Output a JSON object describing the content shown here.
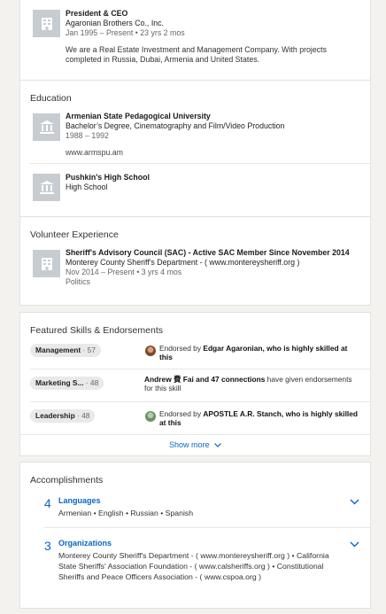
{
  "experience": {
    "title": "President & CEO",
    "company": "Agaronian Brothers Co., Inc.",
    "dates": "Jan 1995 – Present  • 23 yrs 2 mos",
    "description": "We are a Real Estate Investment and Management Company. With projects completed in Russia, Dubai, Armenia and United States.",
    "icon": "building-icon"
  },
  "education": {
    "heading": "Education",
    "schools": [
      {
        "name": "Armenian State Pedagogical University",
        "degree": "Bachelor’s Degree, Cinematography and Film/Video Production",
        "dates": "1988 – 1992",
        "link": "www.armspu.am",
        "icon": "school-icon"
      },
      {
        "name": "Pushkin's High School",
        "degree": "High School",
        "icon": "school-icon"
      }
    ]
  },
  "volunteer": {
    "heading": "Volunteer Experience",
    "role": "Sheriff's Advisory Council (SAC) - Active SAC Member Since November 2014",
    "org": "Monterey County Sheriff's Department - ( www.montereysheriff.org )",
    "dates": "Nov 2014 – Present  • 3 yrs 4 mos",
    "cause": "Politics",
    "icon": "building-icon"
  },
  "skills": {
    "heading": "Featured Skills & Endorsements",
    "items": [
      {
        "name": "Management",
        "count": "57",
        "prefix": "Endorsed by ",
        "endorser": "Edgar Agaronian, who is highly skilled at this",
        "suffix": ""
      },
      {
        "name": "Marketing S...",
        "count": "48",
        "prefix": "",
        "endorser": "Andrew 費 Fai and 47 connections",
        "suffix": " have given endorsements for this skill"
      },
      {
        "name": "Leadership",
        "count": "48",
        "prefix": "Endorsed by ",
        "endorser": "APOSTLE A.R. Stanch, who is highly skilled at this",
        "suffix": ""
      }
    ],
    "show_more": "Show more"
  },
  "accomplishments": {
    "heading": "Accomplishments",
    "items": [
      {
        "count": "4",
        "title": "Languages",
        "text": "Armenian  • English  • Russian  • Spanish"
      },
      {
        "count": "3",
        "title": "Organizations",
        "text": "Monterey County Sheriff's Department - ( www.montereysheriff.org )  • California State Sheriffs' Association Foundation - ( www.calsheriffs.org )  • Constitutional Sheriffs and Peace Officers Association - ( www.cspoa.org )"
      }
    ]
  },
  "colors": {
    "link": "#0a66c2",
    "logo_bg": "#c7ccd1",
    "page_bg": "#f3f2ef"
  }
}
